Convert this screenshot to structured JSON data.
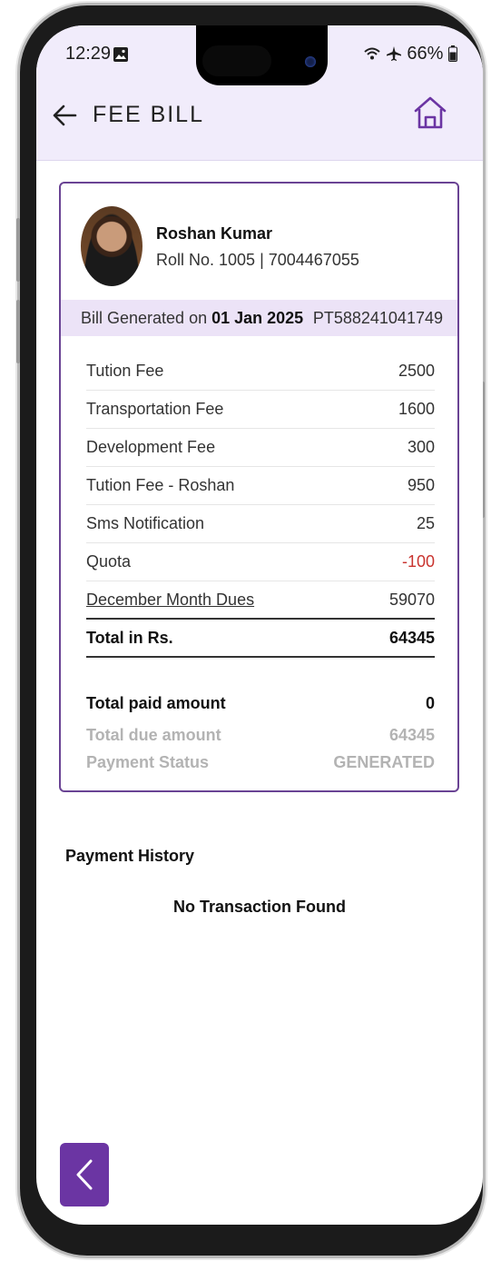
{
  "status_bar": {
    "time": "12:29",
    "battery": "66%"
  },
  "header": {
    "title": "FEE BILL"
  },
  "student": {
    "name": "Roshan Kumar",
    "meta": "Roll No. 1005 | 7004467055"
  },
  "bill": {
    "generated_prefix": "Bill Generated on ",
    "generated_date": "01 Jan 2025",
    "bill_id": "PT588241041749"
  },
  "fees": [
    {
      "label": "Tution Fee",
      "amount": "2500"
    },
    {
      "label": "Transportation Fee",
      "amount": "1600"
    },
    {
      "label": "Development Fee",
      "amount": "300"
    },
    {
      "label": "Tution Fee - Roshan",
      "amount": "950"
    },
    {
      "label": "Sms Notification",
      "amount": "25"
    },
    {
      "label": "Quota",
      "amount": "-100"
    },
    {
      "label": "December Month Dues",
      "amount": "59070"
    }
  ],
  "total": {
    "label": "Total in Rs.",
    "amount": "64345"
  },
  "summary": {
    "paid_label": "Total paid amount",
    "paid_value": "0",
    "due_label": "Total due amount",
    "due_value": "64345",
    "status_label": "Payment Status",
    "status_value": "GENERATED"
  },
  "payment_history": {
    "title": "Payment History",
    "empty_text": "No Transaction Found"
  },
  "colors": {
    "accent": "#6b35a3",
    "header_bg": "#f1ecfb",
    "negative": "#c9342f"
  },
  "icons": [
    "back-arrow-icon",
    "home-icon",
    "chevron-left-icon",
    "wifi-icon",
    "airplane-icon",
    "battery-icon",
    "image-icon"
  ]
}
